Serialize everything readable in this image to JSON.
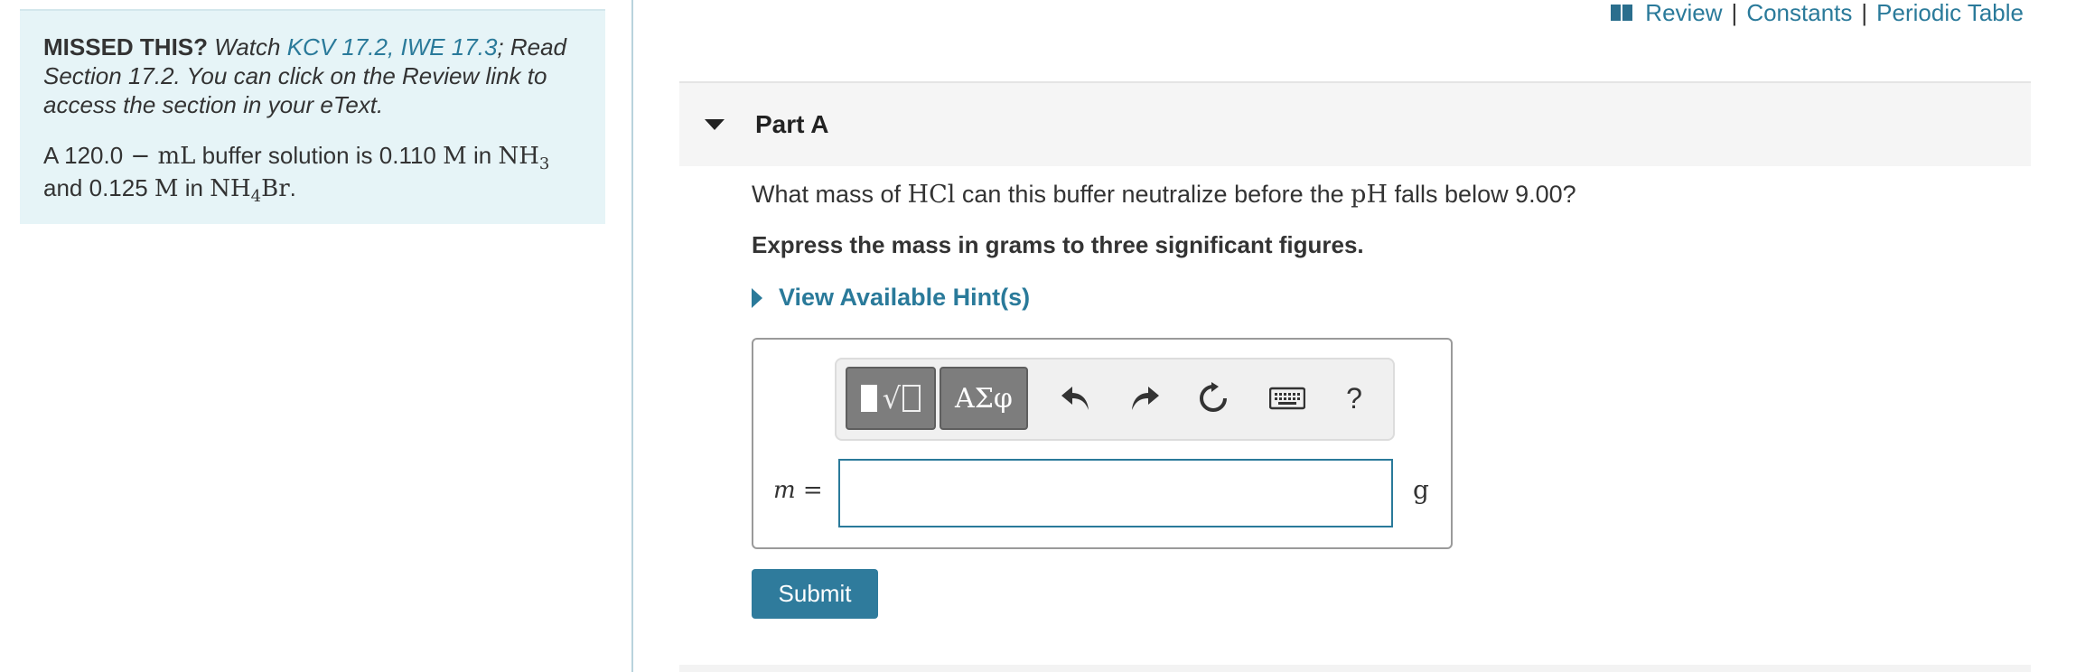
{
  "sidebar": {
    "missed_label": "MISSED THIS?",
    "watch_prefix": "Watch",
    "links": [
      "KCV 17.2",
      "IWE 17.3"
    ],
    "link_comma": ",",
    "read_text": "; Read Section 17.2. You can click on the Review link to access the section in your eText.",
    "problem": {
      "p1": "A 120.0",
      "dash": " − ",
      "unit_ml": "mL",
      "p2": " buffer solution is 0.110 ",
      "unit_m": "M",
      "p3": " in ",
      "nh3": "NH",
      "nh3_sub": "3",
      "p4": "and 0.125 ",
      "unit_m2": "M",
      "p5": " in ",
      "nh4br_a": "NH",
      "nh4br_sub": "4",
      "nh4br_b": "Br",
      "p6": "."
    }
  },
  "top_links": {
    "review": "Review",
    "separator": "|",
    "constants": "Constants",
    "periodic_table": "Periodic Table",
    "icon": "book-icon"
  },
  "part": {
    "title": "Part A",
    "question_a": "What mass of ",
    "question_hcl": "HCl",
    "question_b": " can this buffer neutralize before the ",
    "question_ph": "pH",
    "question_c": " falls below 9.00?",
    "instruction": "Express the mass in grams to three significant figures.",
    "hint_label": "View Available Hint(s)"
  },
  "answer": {
    "toolbar": {
      "greek_label": "ΑΣφ",
      "help_label": "?",
      "icons": [
        "templates-icon",
        "greek-letters-icon",
        "undo-icon",
        "redo-icon",
        "reset-icon",
        "keyboard-icon",
        "help-icon"
      ]
    },
    "variable": "m",
    "equals": " =",
    "value": "",
    "unit": "g"
  },
  "submit_label": "Submit",
  "colors": {
    "link": "#2a7a9a",
    "submit_bg": "#2f7b9c",
    "sidebar_bg": "#e6f4f7",
    "part_header_bg": "#f5f5f5"
  }
}
